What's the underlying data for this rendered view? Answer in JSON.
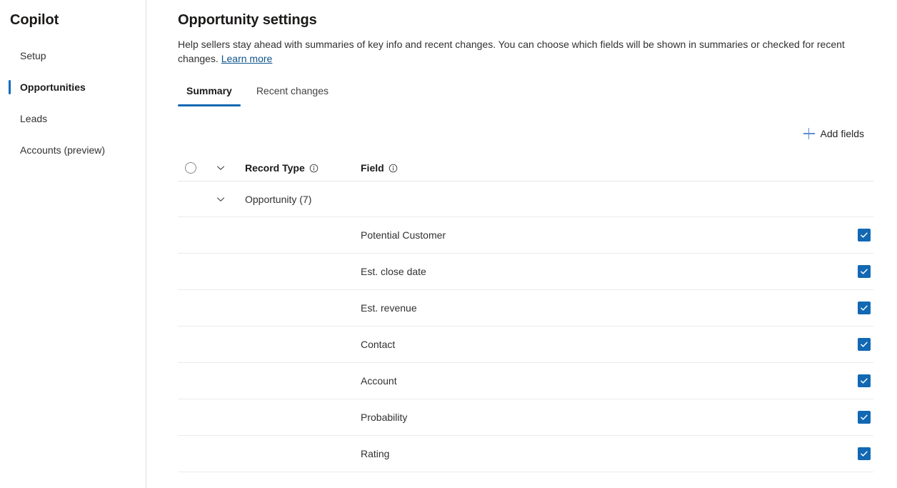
{
  "sidebar": {
    "title": "Copilot",
    "items": [
      {
        "label": "Setup",
        "selected": false
      },
      {
        "label": "Opportunities",
        "selected": true
      },
      {
        "label": "Leads",
        "selected": false
      },
      {
        "label": "Accounts (preview)",
        "selected": false
      }
    ]
  },
  "main": {
    "page_title": "Opportunity settings",
    "description": "Help sellers stay ahead with summaries of key info and recent changes. You can choose which fields will be shown in summaries or checked for recent changes.",
    "learn_more_label": "Learn more",
    "tabs": [
      {
        "label": "Summary",
        "active": true
      },
      {
        "label": "Recent changes",
        "active": false
      }
    ],
    "toolbar": {
      "add_fields_label": "Add fields",
      "add_fields_icon": "plus-icon"
    },
    "table": {
      "columns": {
        "record_type": "Record Type",
        "field": "Field"
      },
      "select_all_icon": "circle-unchecked-icon",
      "header_chevron_icon": "chevron-down-icon",
      "info_icon": "info-icon",
      "group": {
        "label": "Opportunity (7)",
        "chevron_icon": "chevron-down-icon",
        "count": 7
      },
      "rows": [
        {
          "field": "Potential Customer",
          "checked": true
        },
        {
          "field": "Est. close date",
          "checked": true
        },
        {
          "field": "Est. revenue",
          "checked": true
        },
        {
          "field": "Contact",
          "checked": true
        },
        {
          "field": "Account",
          "checked": true
        },
        {
          "field": "Probability",
          "checked": true
        },
        {
          "field": "Rating",
          "checked": true
        }
      ]
    }
  },
  "colors": {
    "brand_blue": "#1268b3",
    "accent_blue": "#0f6cbd",
    "link_blue": "#0f548c",
    "divider": "#edebe9",
    "text_primary": "#323130"
  }
}
